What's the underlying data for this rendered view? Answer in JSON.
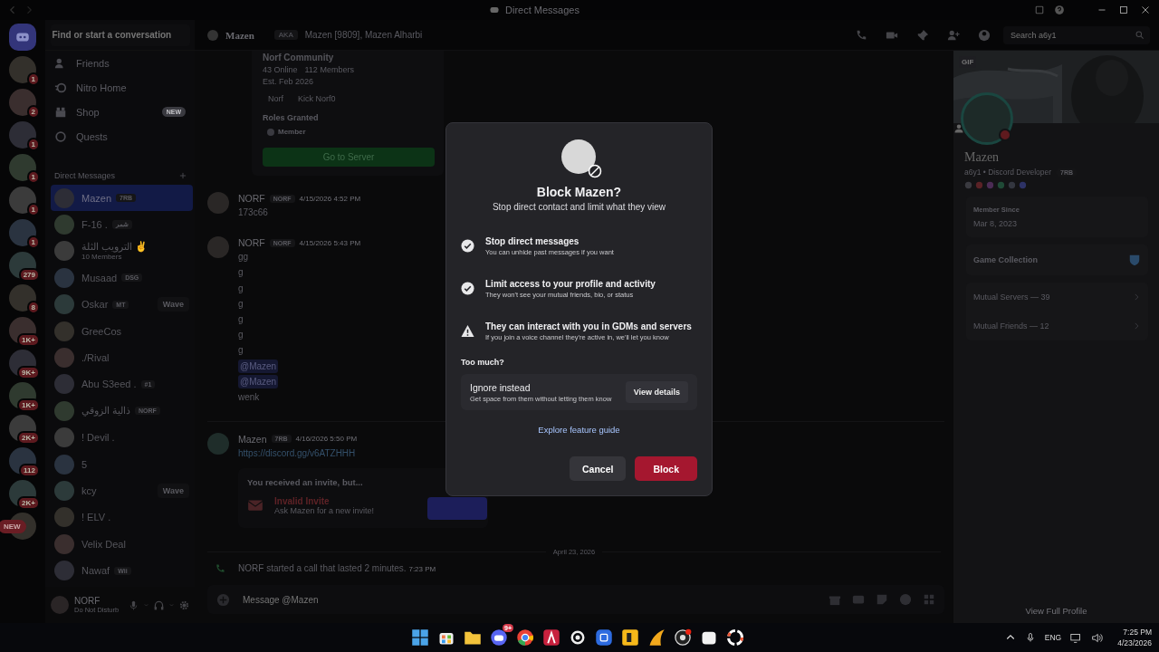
{
  "window": {
    "title": "Direct Messages"
  },
  "servers": [
    {
      "kind": "home"
    },
    {
      "kind": "server",
      "badge": "1"
    },
    {
      "kind": "server",
      "badge": "2"
    },
    {
      "kind": "server",
      "badge": "1"
    },
    {
      "kind": "server",
      "badge": "1"
    },
    {
      "kind": "server",
      "badge": "1"
    },
    {
      "kind": "server",
      "badge": "1"
    },
    {
      "kind": "server",
      "badge": "279"
    },
    {
      "kind": "server",
      "badge": "8"
    },
    {
      "kind": "server",
      "badge": "1K+"
    },
    {
      "kind": "server",
      "badge": "9K+"
    },
    {
      "kind": "server",
      "badge": "1K+"
    },
    {
      "kind": "server",
      "badge": "2K+"
    },
    {
      "kind": "server",
      "badge": "112"
    },
    {
      "kind": "server",
      "badge": "2K+"
    },
    {
      "kind": "server",
      "pill": "NEW"
    }
  ],
  "sidebar": {
    "placeholder": "Find or start a conversation",
    "nav": [
      {
        "kind": "friends",
        "label": "Friends"
      },
      {
        "kind": "nitro",
        "label": "Nitro Home"
      },
      {
        "kind": "shop",
        "label": "Shop",
        "badge": "NEW"
      },
      {
        "kind": "quests",
        "label": "Quests"
      }
    ],
    "dm_header": "Direct Messages",
    "dms": [
      {
        "name": "Mazen",
        "tag": "7RB",
        "selected": true
      },
      {
        "name": "F-16 .",
        "tag": "شمر",
        "selected": false
      },
      {
        "name": "الترويب الثلة ✌",
        "sub": "10 Members",
        "selected": false
      },
      {
        "name": "Musaad",
        "tag": "DSG",
        "selected": false
      },
      {
        "name": "Oskar",
        "tag": "MT",
        "action": "Wave",
        "selected": false
      },
      {
        "name": "GreeCos",
        "selected": false
      },
      {
        "name": "./Rival",
        "selected": false
      },
      {
        "name": "Abu S3eed .",
        "tag": "#1",
        "selected": false
      },
      {
        "name": "ذالية الزوقي",
        "tag": "NORF",
        "selected": false
      },
      {
        "name": "! Devil .",
        "selected": false
      },
      {
        "name": "5",
        "selected": false
      },
      {
        "name": "kcy",
        "action": "Wave",
        "selected": false
      },
      {
        "name": "! ELV .",
        "selected": false
      },
      {
        "name": "Velix Deal",
        "selected": false
      },
      {
        "name": "Nawaf",
        "tag": "Wii",
        "selected": false
      }
    ],
    "user": {
      "name": "NORF",
      "status": "Do Not Disturb"
    }
  },
  "header": {
    "name": "Mazen",
    "aka": "AKA",
    "aliases": "Mazen [9809], Mazen Alharbi",
    "search_placeholder": "Search a6y1"
  },
  "chat": {
    "embed": {
      "title": "Norf Community",
      "online": "43 Online",
      "members": "112 Members",
      "established": "Est. Feb 2026",
      "channels": [
        "Norf",
        "Kick Norf0"
      ],
      "roles_heading": "Roles Granted",
      "roles": [
        "Member"
      ],
      "button": "Go to Server"
    },
    "messages": [
      {
        "author": "NORF",
        "tag": "NORF",
        "time": "4/15/2026 4:52 PM",
        "lines": [
          {
            "kind": "text",
            "text": "173c66"
          }
        ]
      },
      {
        "author": "NORF",
        "tag": "NORF",
        "time": "4/15/2026 5:43 PM",
        "lines": [
          {
            "kind": "text",
            "text": "gg"
          },
          {
            "kind": "text",
            "text": "g"
          },
          {
            "kind": "text",
            "text": "g"
          },
          {
            "kind": "text",
            "text": "g"
          },
          {
            "kind": "text",
            "text": "g"
          },
          {
            "kind": "text",
            "text": "g"
          },
          {
            "kind": "text",
            "text": "g"
          },
          {
            "kind": "mention",
            "text": "@Mazen"
          },
          {
            "kind": "mention",
            "text": "@Mazen"
          },
          {
            "kind": "text",
            "text": "wenk"
          }
        ]
      },
      {
        "author": "Mazen",
        "tag": "7RB",
        "time": "4/16/2026 5:50 PM",
        "lines": [
          {
            "kind": "link",
            "text": "https://discord.gg/v6ATZHHH"
          }
        ],
        "invite": {
          "heading": "You received an invite, but...",
          "title": "Invalid Invite",
          "subtitle": "Ask Mazen for a new invite!"
        }
      }
    ],
    "divider": "April 23, 2026",
    "call": {
      "author": "NORF",
      "text": "started a call that lasted 2 minutes.",
      "time": "7:23 PM"
    },
    "composer": {
      "placeholder": "Message @Mazen"
    }
  },
  "profile": {
    "gif": "GIF",
    "name": "Mazen",
    "username": "a6y1 • Discord Developer",
    "tag": "7RB",
    "member_since_label": "Member Since",
    "member_since": "Mar 8, 2023",
    "game_collection": "Game Collection",
    "rows": [
      "Mutual Servers — 39",
      "Mutual Friends — 12"
    ],
    "footer": "View Full Profile"
  },
  "modal": {
    "title": "Block Mazen?",
    "subtitle": "Stop direct contact and limit what they view",
    "items": [
      {
        "kind": "check",
        "title": "Stop direct messages",
        "text": "You can unhide past messages if you want"
      },
      {
        "kind": "check",
        "title": "Limit access to your profile and activity",
        "text": "They won't see your mutual friends, bio, or status"
      },
      {
        "kind": "warning",
        "title": "They can interact with you in GDMs and servers",
        "text": "If you join a voice channel they're active in, we'll let you know"
      }
    ],
    "too_much": "Too much?",
    "ignore": {
      "title": "Ignore instead",
      "text": "Get space from them without letting them know",
      "button": "View details"
    },
    "link": "Explore feature guide",
    "buttons": [
      {
        "kind": "secondary",
        "label": "Cancel"
      },
      {
        "kind": "danger",
        "label": "Block"
      }
    ]
  },
  "taskbar": {
    "apps": [
      {
        "kind": "start"
      },
      {
        "kind": "store"
      },
      {
        "kind": "folder"
      },
      {
        "kind": "chat",
        "badge": "9+"
      },
      {
        "kind": "browser"
      },
      {
        "kind": "red"
      },
      {
        "kind": "gear"
      },
      {
        "kind": "blue"
      },
      {
        "kind": "yellow"
      },
      {
        "kind": "fin"
      },
      {
        "kind": "record"
      },
      {
        "kind": "white"
      },
      {
        "kind": "ring"
      }
    ],
    "tray": {
      "language": "ENG",
      "time": "7:25 PM",
      "date": "4/23/2026"
    }
  }
}
